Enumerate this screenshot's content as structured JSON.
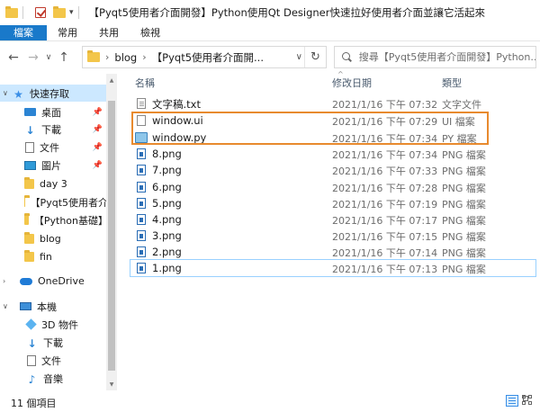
{
  "window": {
    "title": "【Pyqt5使用者介面開發】Python使用Qt Designer快速拉好使用者介面並讓它活起來"
  },
  "ribbon": {
    "tabs": [
      "檔案",
      "常用",
      "共用",
      "檢視"
    ]
  },
  "address": {
    "crumbs": [
      "blog",
      "【Pyqt5使用者介面開..."
    ]
  },
  "search": {
    "placeholder": "搜尋【Pyqt5使用者介面開發】Python..."
  },
  "sidebar": {
    "quick_access": "快速存取",
    "items": [
      {
        "label": "桌面",
        "icon": "desktop-icon",
        "pinned": true
      },
      {
        "label": "下載",
        "icon": "download-icon",
        "pinned": true
      },
      {
        "label": "文件",
        "icon": "documents-icon",
        "pinned": true
      },
      {
        "label": "圖片",
        "icon": "pictures-icon",
        "pinned": true
      },
      {
        "label": "day 3",
        "icon": "folder-icon",
        "pinned": false
      },
      {
        "label": "【Pyqt5使用者介",
        "icon": "folder-icon",
        "pinned": false
      },
      {
        "label": "【Python基礎】",
        "icon": "folder-icon",
        "pinned": false
      },
      {
        "label": "blog",
        "icon": "folder-icon",
        "pinned": false
      },
      {
        "label": "fin",
        "icon": "folder-icon",
        "pinned": false
      }
    ],
    "onedrive": "OneDrive",
    "this_pc": "本機",
    "pc_items": [
      {
        "label": "3D 物件",
        "icon": "3d-objects-icon"
      },
      {
        "label": "下載",
        "icon": "download-icon"
      },
      {
        "label": "文件",
        "icon": "documents-icon"
      },
      {
        "label": "音樂",
        "icon": "music-icon"
      }
    ]
  },
  "columns": {
    "name": "名稱",
    "date": "修改日期",
    "type": "類型"
  },
  "files": [
    {
      "name": "文字稿.txt",
      "date": "2021/1/16 下午 07:32",
      "type": "文字文件",
      "icon": "txt"
    },
    {
      "name": "window.ui",
      "date": "2021/1/16 下午 07:29",
      "type": "UI 檔案",
      "icon": "ui"
    },
    {
      "name": "window.py",
      "date": "2021/1/16 下午 07:34",
      "type": "PY 檔案",
      "icon": "py"
    },
    {
      "name": "8.png",
      "date": "2021/1/16 下午 07:34",
      "type": "PNG 檔案",
      "icon": "png"
    },
    {
      "name": "7.png",
      "date": "2021/1/16 下午 07:33",
      "type": "PNG 檔案",
      "icon": "png"
    },
    {
      "name": "6.png",
      "date": "2021/1/16 下午 07:28",
      "type": "PNG 檔案",
      "icon": "png"
    },
    {
      "name": "5.png",
      "date": "2021/1/16 下午 07:19",
      "type": "PNG 檔案",
      "icon": "png"
    },
    {
      "name": "4.png",
      "date": "2021/1/16 下午 07:17",
      "type": "PNG 檔案",
      "icon": "png"
    },
    {
      "name": "3.png",
      "date": "2021/1/16 下午 07:15",
      "type": "PNG 檔案",
      "icon": "png"
    },
    {
      "name": "2.png",
      "date": "2021/1/16 下午 07:14",
      "type": "PNG 檔案",
      "icon": "png"
    },
    {
      "name": "1.png",
      "date": "2021/1/16 下午 07:13",
      "type": "PNG 檔案",
      "icon": "png"
    }
  ],
  "status": {
    "count": "11 個項目"
  },
  "colors": {
    "accent": "#1979ca",
    "highlight": "#e88a2e",
    "selection": "#cce8ff"
  }
}
